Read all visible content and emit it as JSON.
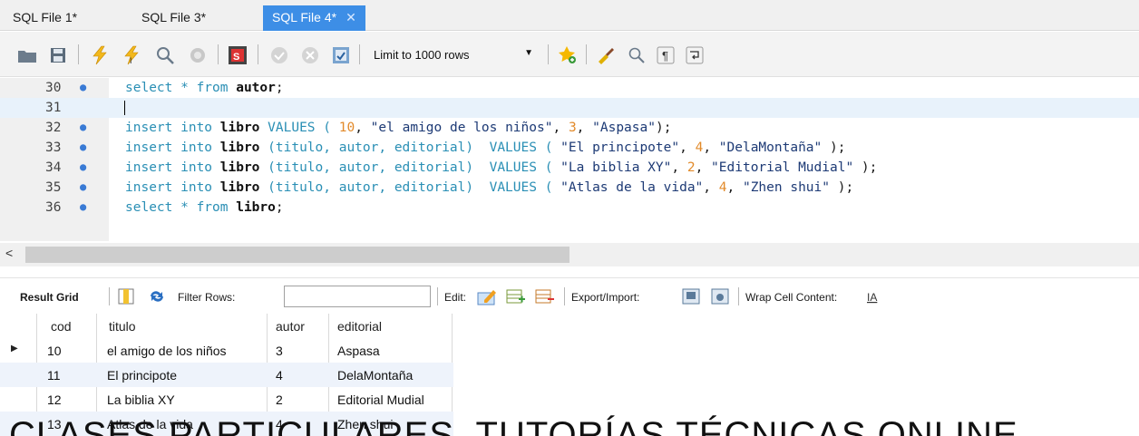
{
  "tabs": [
    {
      "label": "SQL File 1*"
    },
    {
      "label": "SQL File 3*"
    },
    {
      "label": "SQL File 4*"
    }
  ],
  "toolbar": {
    "limit_label": "Limit to 1000 rows"
  },
  "editor": {
    "lines": [
      {
        "num": "30",
        "has_dot": true
      },
      {
        "num": "31",
        "has_dot": false
      },
      {
        "num": "32",
        "has_dot": true
      },
      {
        "num": "33",
        "has_dot": true
      },
      {
        "num": "34",
        "has_dot": true
      },
      {
        "num": "35",
        "has_dot": true
      },
      {
        "num": "36",
        "has_dot": true
      }
    ],
    "code": {
      "l30": [
        "select * from ",
        "autor",
        ";"
      ],
      "l32": [
        "insert into ",
        "libro",
        " VALUES ( ",
        "10",
        ", ",
        "\"el amigo de los niños\"",
        ", ",
        "3",
        ", ",
        "\"Aspasa\"",
        ");"
      ],
      "l33": [
        "insert into ",
        "libro",
        " (titulo, autor, editorial)  VALUES ( ",
        "\"El principote\"",
        ", ",
        "4",
        ", ",
        "\"DelaMontaña\"",
        " );"
      ],
      "l34": [
        "insert into ",
        "libro",
        " (titulo, autor, editorial)  VALUES ( ",
        "\"La biblia XY\"",
        ", ",
        "2",
        ", ",
        "\"Editorial Mudial\"",
        " );"
      ],
      "l35": [
        "insert into ",
        "libro",
        " (titulo, autor, editorial)  VALUES ( ",
        "\"Atlas de la vida\"",
        ", ",
        "4",
        ", ",
        "\"Zhen shui\"",
        " );"
      ],
      "l36": [
        "select * from ",
        "libro",
        ";"
      ]
    }
  },
  "result_toolbar": {
    "result_grid": "Result Grid",
    "filter_rows": "Filter Rows:",
    "filter_value": "",
    "edit": "Edit:",
    "export_import": "Export/Import:",
    "wrap": "Wrap Cell Content:"
  },
  "grid": {
    "columns": [
      "cod",
      "titulo",
      "autor",
      "editorial"
    ],
    "rows": [
      [
        "10",
        "el amigo de los niños",
        "3",
        "Aspasa"
      ],
      [
        "11",
        "El principote",
        "4",
        "DelaMontaña"
      ],
      [
        "12",
        "La biblia XY",
        "2",
        "Editorial Mudial"
      ],
      [
        "13",
        "Atlas de la vida",
        "4",
        "Zhen shui"
      ]
    ]
  },
  "watermark": "CLASES PARTICULARES, TUTORÍAS TÉCNICAS ONLINE",
  "colors": {
    "active_tab": "#3d8ee6",
    "keyword": "#2a8fb5",
    "number": "#e28a2a",
    "string": "#1d3a75",
    "statement_dot": "#3a7bd5"
  }
}
